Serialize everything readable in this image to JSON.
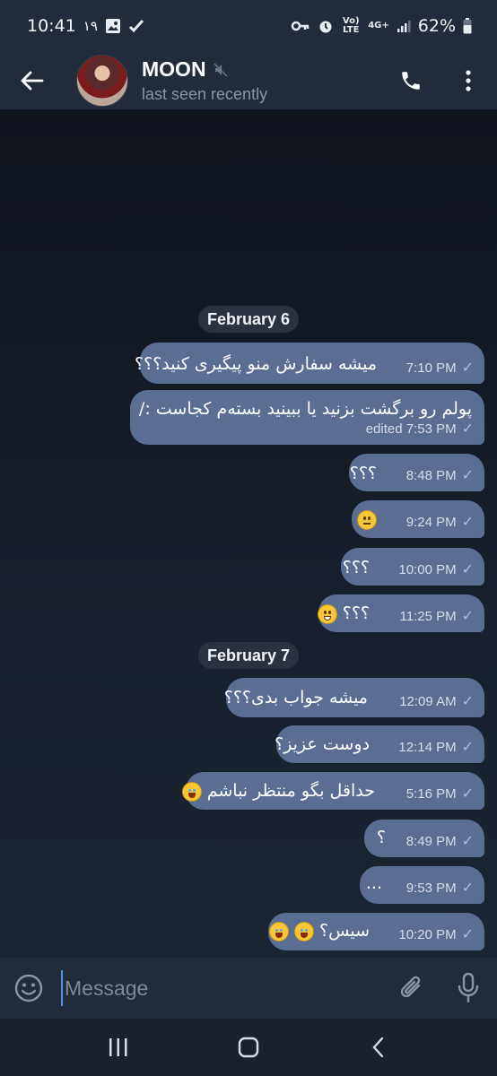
{
  "status_bar": {
    "time": "10:41",
    "date_short": "۱۹",
    "network": "4G+",
    "volte": "Vo) LTE",
    "battery": "62%"
  },
  "header": {
    "contact_name": "MOON",
    "status": "last seen recently",
    "muted_icon": "mute-icon",
    "icons": [
      "back-arrow-icon",
      "phone-icon",
      "more-vertical-icon"
    ]
  },
  "chat": {
    "date_chips": [
      {
        "label": "February 6"
      },
      {
        "label": "February 7"
      }
    ],
    "messages": [
      {
        "text": "میشه سفارش منو پیگیری کنید؟؟؟",
        "time": "7:10 PM",
        "status": "sent"
      },
      {
        "text": "پولم رو برگشت بزنید یا ببینید بسته‌م کجاست :/",
        "time": "edited 7:53 PM",
        "status": "sent"
      },
      {
        "text": "؟؟؟",
        "time": "8:48 PM",
        "status": "sent"
      },
      {
        "text": "",
        "emoji": "neutral-face",
        "time": "9:24 PM",
        "status": "sent"
      },
      {
        "text": "؟؟؟",
        "time": "10:00 PM",
        "status": "sent"
      },
      {
        "text": "؟؟؟",
        "emoji": "grinning-face",
        "time": "11:25 PM",
        "status": "sent"
      },
      {
        "text": "میشه جواب بدی؟؟؟",
        "time": "12:09 AM",
        "status": "sent"
      },
      {
        "text": "دوست عزیز؟",
        "time": "12:14 PM",
        "status": "sent"
      },
      {
        "text": "حداقل بگو منتظر نباشم",
        "emoji": "joy-face",
        "time": "5:16 PM",
        "status": "sent"
      },
      {
        "text": "؟",
        "time": "8:49 PM",
        "status": "sent"
      },
      {
        "text": "...",
        "time": "9:53 PM",
        "status": "sent"
      },
      {
        "text": "سیس؟",
        "emoji": "joy-face",
        "time": "10:20 PM",
        "status": "sent"
      }
    ]
  },
  "composer": {
    "placeholder": "Message",
    "icons": [
      "emoji-icon",
      "attach-icon",
      "mic-icon"
    ]
  },
  "colors": {
    "bubble": "#5a6e93",
    "header": "#222b39",
    "background": "#0f1520",
    "check": "#9ec2f0"
  }
}
